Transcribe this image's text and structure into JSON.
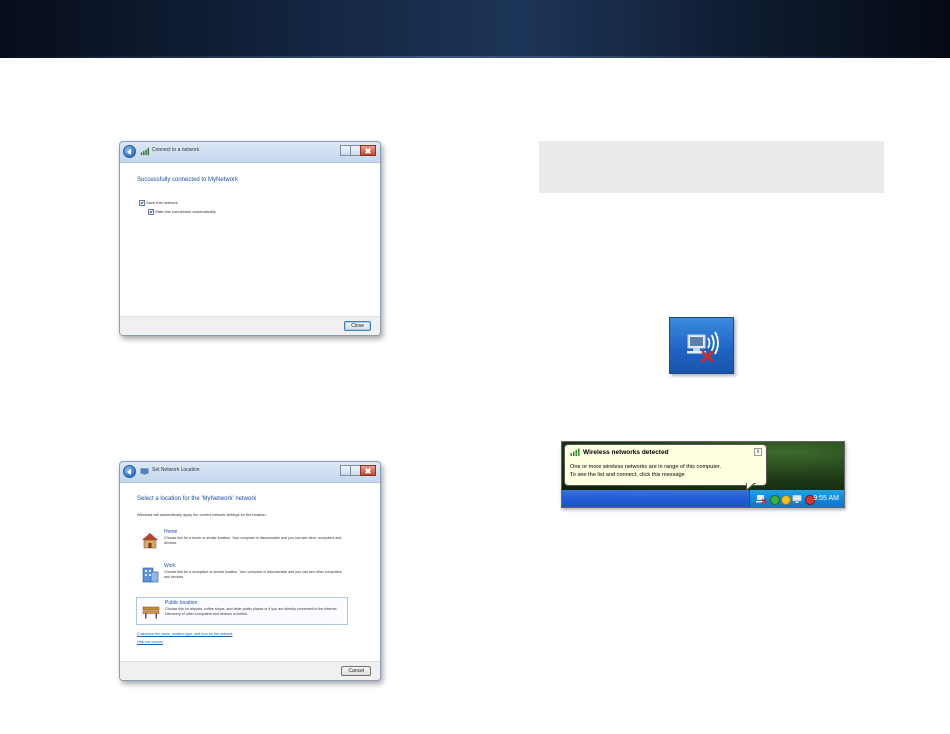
{
  "dialog_connect": {
    "title": "Connect to a network",
    "heading": "Successfully connected to MyNetwork",
    "save_network_label": "Save this network",
    "start_auto_label": "Start this connection automatically",
    "close_button": "Close"
  },
  "dialog_location": {
    "title": "Set Network Location",
    "heading": "Select a location for the 'MyNetwork' network",
    "intro": "Windows will automatically apply the correct network settings for the location.",
    "locations": [
      {
        "title": "Home",
        "description": "Choose this for a home or similar location. Your computer is discoverable and you can see other computers and devices."
      },
      {
        "title": "Work",
        "description": "Choose this for a workplace or similar location. Your computer is discoverable and you can see other computers and devices."
      },
      {
        "title": "Public location",
        "description": "Choose this for airports, coffee shops, and other public places or if you are directly connected to the Internet. Discovery of other computers and devices is limited."
      }
    ],
    "customize_link": "Customize the name, location type, and icon for the network",
    "help_link": "Help me choose",
    "cancel_button": "Cancel"
  },
  "xp_notification": {
    "title": "Wireless networks detected",
    "line1": "One or more wireless networks are in range of this computer.",
    "line2": "To see the list and connect, click this message",
    "close_glyph": "x",
    "clock": "9:55 AM"
  },
  "icons": {
    "back": "back-arrow-icon",
    "wireless_network": "wireless-network-icon",
    "wireless_disconnected": "wireless-disconnected-icon",
    "home": "home-icon",
    "work": "work-building-icon",
    "public": "park-bench-icon"
  },
  "colors": {
    "heading_blue": "#1f4ea3",
    "banner_dark": "#0e1a2e",
    "xp_taskbar": "#245edb",
    "balloon_bg": "#ffffe1",
    "gray_box": "#eaeaea"
  }
}
